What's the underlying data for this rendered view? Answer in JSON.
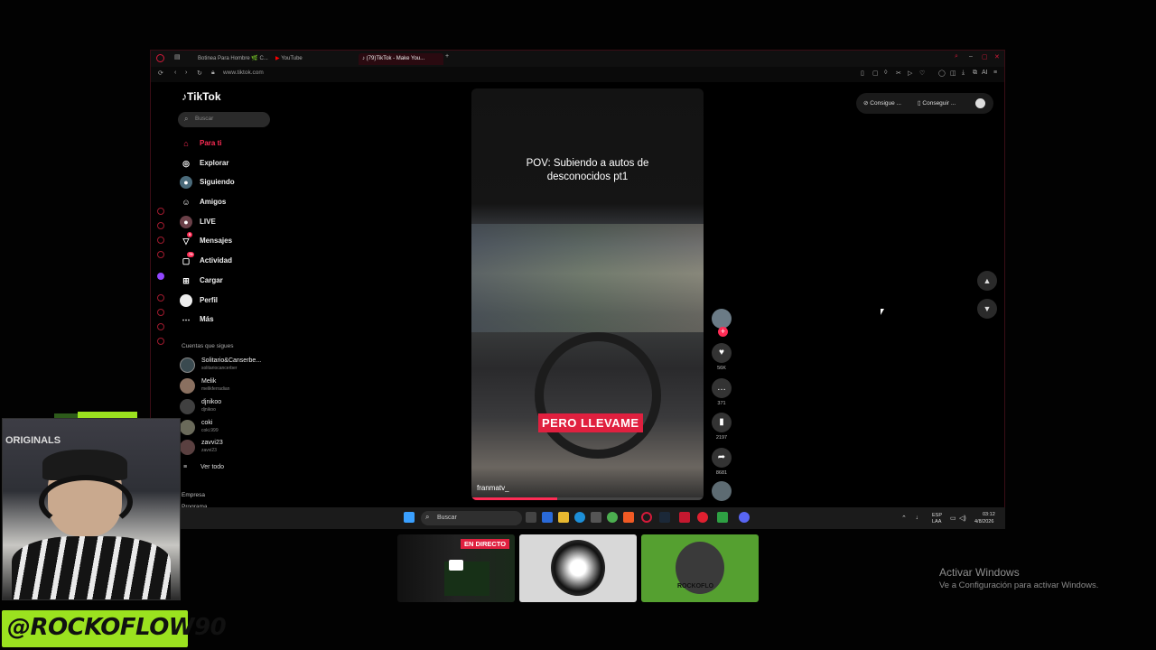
{
  "browser": {
    "tabs": [
      {
        "label": "Botinea Para Hombre 🌿 C..."
      },
      {
        "label": "YouTube"
      },
      {
        "label": "(79)TikTok - Make You..."
      }
    ],
    "new_tab_glyph": "+",
    "url": "www.tiktok.com",
    "toolbar_ai_label": "AI"
  },
  "tiktok": {
    "logo": "TikTok",
    "search_placeholder": "Buscar",
    "nav": [
      {
        "label": "Para ti",
        "icon": "home-icon",
        "glyph": "⌂"
      },
      {
        "label": "Explorar",
        "icon": "compass-icon",
        "glyph": "◎"
      },
      {
        "label": "Siguiendo",
        "icon": "following-icon",
        "glyph": "●"
      },
      {
        "label": "Amigos",
        "icon": "friends-icon",
        "glyph": "☺"
      },
      {
        "label": "LIVE",
        "icon": "live-icon",
        "glyph": "●"
      },
      {
        "label": "Mensajes",
        "icon": "messages-icon",
        "glyph": "▽",
        "badge": "5"
      },
      {
        "label": "Actividad",
        "icon": "activity-icon",
        "glyph": "▢",
        "badge": "79"
      },
      {
        "label": "Cargar",
        "icon": "upload-icon",
        "glyph": "⊞"
      },
      {
        "label": "Perfil",
        "icon": "profile-icon",
        "glyph": "●"
      },
      {
        "label": "Más",
        "icon": "more-icon",
        "glyph": "⋯"
      }
    ],
    "following_title": "Cuentas que sigues",
    "following": [
      {
        "name": "Solitario&Canserbe...",
        "handle": "solitariocancerber"
      },
      {
        "name": "Melik",
        "handle": "melikferradian"
      },
      {
        "name": "djnikoo",
        "handle": "djnikoo"
      },
      {
        "name": "coki",
        "handle": "coki.999"
      },
      {
        "name": "zavvi23",
        "handle": "zavvi23"
      }
    ],
    "see_all": "Ver todo",
    "see_all_glyph": "≡",
    "footer": [
      "Empresa",
      "Programa"
    ],
    "get_app": [
      "Consigue ...",
      "Conseguir ..."
    ],
    "video": {
      "title_line1": "POV: Subiendo a autos de",
      "title_line2": "desconocidos pt1",
      "caption": "PERO LLEVAME",
      "author": "franmatv_",
      "progress": 0.37
    },
    "actions": {
      "likes": "56K",
      "comments": "371",
      "saves": "2197",
      "shares": "8681"
    }
  },
  "taskbar": {
    "search_placeholder": "Buscar",
    "lang1": "ESP",
    "lang2": "LAA",
    "time": "03:12",
    "date": "4/8/2026"
  },
  "overlay": {
    "live_badge": "EN DIRECTO",
    "activate_title": "Activar Windows",
    "activate_sub": "Ve a Configuración para activar Windows.",
    "cam_text": "ORIGINALS",
    "handle": "@ROCKOFLOW90",
    "thumb_text": "ROCKOFLO"
  }
}
